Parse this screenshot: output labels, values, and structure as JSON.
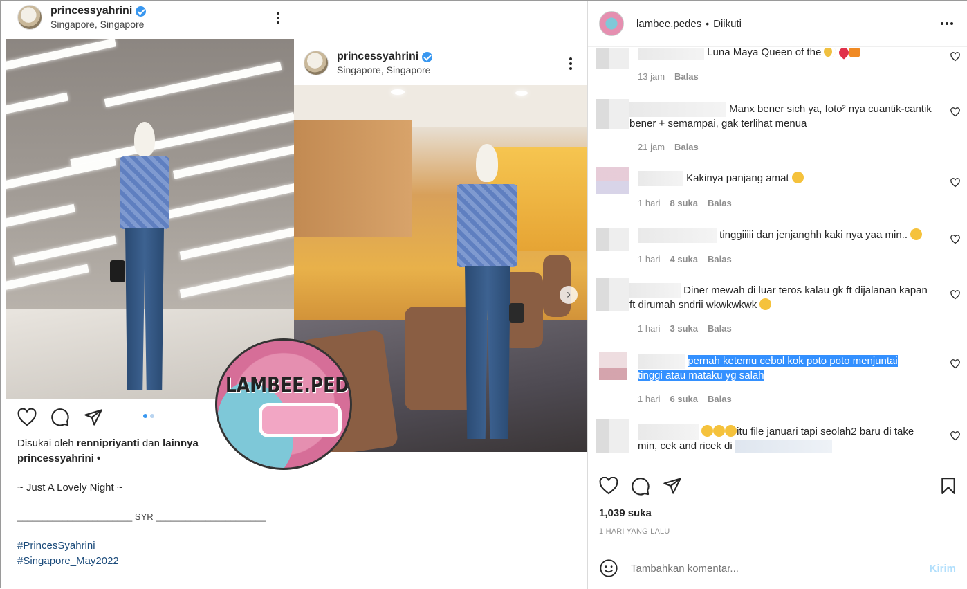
{
  "left_post": {
    "username": "princessyahrini",
    "location": "Singapore, Singapore",
    "liked_by_prefix": "Disukai oleh",
    "liked_by_user": "rennipriyanti",
    "liked_by_and": "dan",
    "liked_by_others": "lainnya",
    "caption_user": "princessyahrini •",
    "caption_line": "~ Just A Lovely Night ~",
    "signature": "_______________________ SYR ______________________",
    "hashtags": [
      "#PrincesSyahrini",
      "#Singapore_May2022"
    ]
  },
  "inner_post": {
    "username": "princessyahrini",
    "location": "Singapore, Singapore"
  },
  "watermark": {
    "text": "LAMBEE.PEDES"
  },
  "panel": {
    "username": "lambee.pedes",
    "separator": "•",
    "follow_status": "Diikuti",
    "likes": "1,039 suka",
    "timestamp": "1 HARI YANG LALU",
    "comment_placeholder": "Tambahkan komentar...",
    "send_label": "Kirim"
  },
  "comments": [
    {
      "text": "Luna Maya Queen of the",
      "time": "13 jam",
      "likes": "",
      "reply": "Balas"
    },
    {
      "text": "Manx bener sich ya, foto² nya cuantik-cantik bener + semampai, gak terlihat menua",
      "time": "21 jam",
      "likes": "",
      "reply": "Balas"
    },
    {
      "text": "Kakinya panjang amat",
      "time": "1 hari",
      "likes": "8 suka",
      "reply": "Balas"
    },
    {
      "text": "tinggiiiii dan jenjanghh kaki nya yaa min..",
      "time": "1 hari",
      "likes": "4 suka",
      "reply": "Balas"
    },
    {
      "text": "Diner mewah di luar teros kalau gk ft dijalanan kapan ft dirumah sndrii wkwkwkwk",
      "time": "1 hari",
      "likes": "3 suka",
      "reply": "Balas"
    },
    {
      "text_line1": "pernah ketemu cebol kok poto poto menjuntai",
      "text_line2": "tinggi atau mataku yg salah",
      "time": "1 hari",
      "likes": "6 suka",
      "reply": "Balas"
    },
    {
      "text": "itu file januari tapi seolah2 baru di take min, cek and ricek di",
      "time": "",
      "likes": "",
      "reply": ""
    }
  ]
}
